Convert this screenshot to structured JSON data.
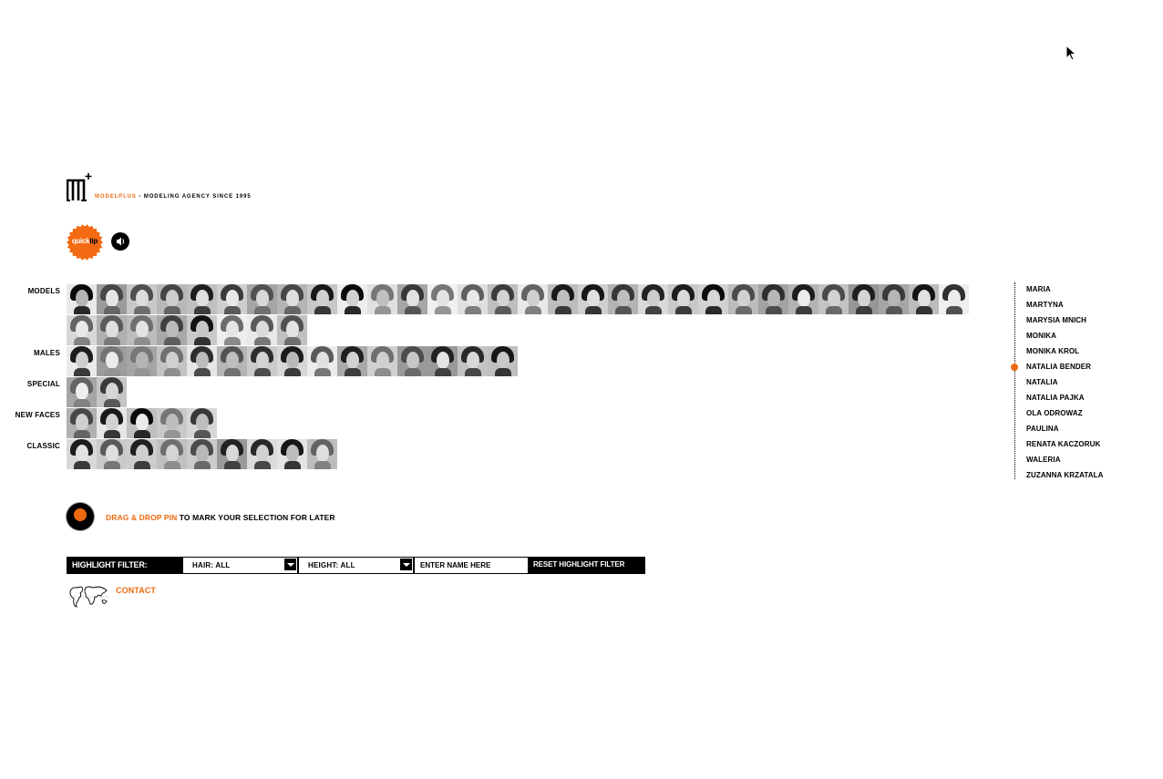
{
  "brand": {
    "name": "MODELPLUS",
    "tagline": " - MODELING AGENCY SINCE 1995",
    "accent_color": "#ee6a10"
  },
  "quick_tip": {
    "part1": "quick",
    "part2": "tip"
  },
  "categories": [
    {
      "key": "models",
      "label": "MODELS",
      "count": 38
    },
    {
      "key": "males",
      "label": "MALES",
      "count": 15
    },
    {
      "key": "special",
      "label": "SPECIAL",
      "count": 2
    },
    {
      "key": "new_faces",
      "label": "NEW FACES",
      "count": 5
    },
    {
      "key": "classic",
      "label": "CLASSIC",
      "count": 9
    }
  ],
  "names": [
    "MARIA",
    "MARTYNA",
    "MARYSIA MNICH",
    "MONIKA",
    "MONIKA KROL",
    "NATALIA BENDER",
    "NATALIA",
    "NATALIA PAJKA",
    "OLA ODROWAZ",
    "PAULINA",
    "RENATA KACZORUK",
    "WALERIA",
    "ZUZANNA KRZATALA"
  ],
  "selected_name_index": 5,
  "pin": {
    "highlight": "DRAG & DROP PIN",
    "rest": " TO MARK YOUR SELECTION FOR LATER"
  },
  "filter": {
    "title": "HIGHLIGHT FILTER:",
    "hair": "HAIR: ALL",
    "height": "HEIGHT: ALL",
    "name_placeholder": "ENTER NAME HERE",
    "reset": "RESET HIGHLIGHT FILTER"
  },
  "contact": "CONTACT"
}
